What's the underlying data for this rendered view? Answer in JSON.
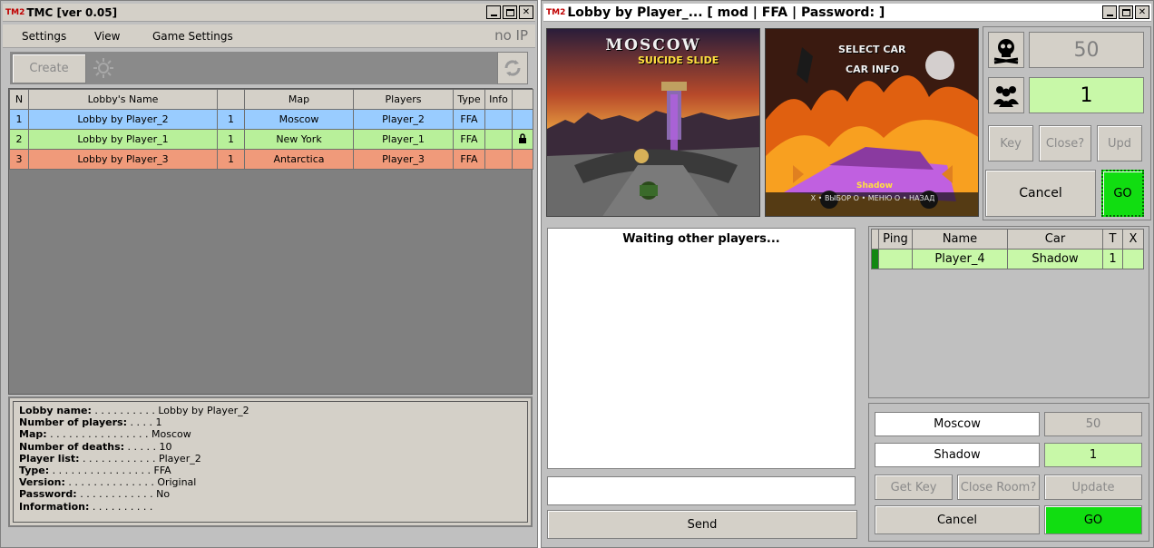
{
  "lobby_window": {
    "logo": "TM2",
    "title": "TMC [ver 0.05]",
    "menu": [
      "Settings",
      "View",
      "Game Settings"
    ],
    "status": "no IP",
    "create_label": "Create",
    "columns": [
      "N",
      "Lobby's Name",
      "",
      "Map",
      "Players",
      "Type",
      "Info"
    ],
    "rows": [
      {
        "n": "1",
        "name": "Lobby by Player_2",
        "count": "1",
        "map": "Moscow",
        "players": "Player_2",
        "type": "FFA",
        "info": "",
        "locked": false,
        "color": "#99ccff"
      },
      {
        "n": "2",
        "name": "Lobby by Player_1",
        "count": "1",
        "map": "New York",
        "players": "Player_1",
        "type": "FFA",
        "info": "",
        "locked": true,
        "color": "#b8f09a"
      },
      {
        "n": "3",
        "name": "Lobby by Player_3",
        "count": "1",
        "map": "Antarctica",
        "players": "Player_3",
        "type": "FFA",
        "info": "",
        "locked": false,
        "color": "#f09a7a"
      }
    ],
    "details": [
      {
        "key": "Lobby name:",
        "dots": " . . . . . . . . . . ",
        "value": "Lobby by Player_2"
      },
      {
        "key": "Number of players:",
        "dots": " . . . . ",
        "value": "1"
      },
      {
        "key": "Map:",
        "dots": " . . . . . . . . . . . . . . . . ",
        "value": "Moscow"
      },
      {
        "key": "Number of deaths:",
        "dots": " . . . . . ",
        "value": "10"
      },
      {
        "key": "Player list:",
        "dots": " . . . . . . . . . . . . ",
        "value": "Player_2"
      },
      {
        "key": "Type:",
        "dots": " . . . . . . . . . . . . . . . . ",
        "value": "FFA"
      },
      {
        "key": "Version:",
        "dots": " . . . . . . . . . . . . . . ",
        "value": "Original"
      },
      {
        "key": "Password:",
        "dots": " . . . . . . . . . . . . ",
        "value": "No"
      },
      {
        "key": "Information:",
        "dots": " . . . . . . . . . . ",
        "value": ""
      }
    ]
  },
  "room_window": {
    "logo": "TM2",
    "title": "Lobby by Player_... [ mod | FFA | Password: ]",
    "map_preview": {
      "line1": "MOSCOW",
      "line2": "SUICIDE SLIDE"
    },
    "car_preview": {
      "line1": "SELECT CAR",
      "line2": "CAR INFO",
      "car_name": "Shadow",
      "footer": "X • ВЫБОР   O • МЕНЮ   O • НАЗАД"
    },
    "deaths": "50",
    "players_count": "1",
    "buttons": {
      "key": "Key",
      "close": "Close?",
      "upd": "Upd",
      "cancel": "Cancel",
      "go": "GO",
      "send": "Send",
      "get_key": "Get Key",
      "close_room": "Close Room?",
      "update": "Update"
    },
    "chat_status": "Waiting other players...",
    "player_columns": [
      "",
      "Ping",
      "Name",
      "Car",
      "T",
      "X"
    ],
    "players": [
      {
        "ping": "",
        "name": "Player_4",
        "car": "Shadow",
        "t": "1",
        "x": ""
      }
    ],
    "settings": {
      "map": "Moscow",
      "deaths": "50",
      "car": "Shadow",
      "players": "1"
    },
    "colors": {
      "go_green": "#11dd11",
      "highlight_green": "#c8f8a8"
    }
  }
}
